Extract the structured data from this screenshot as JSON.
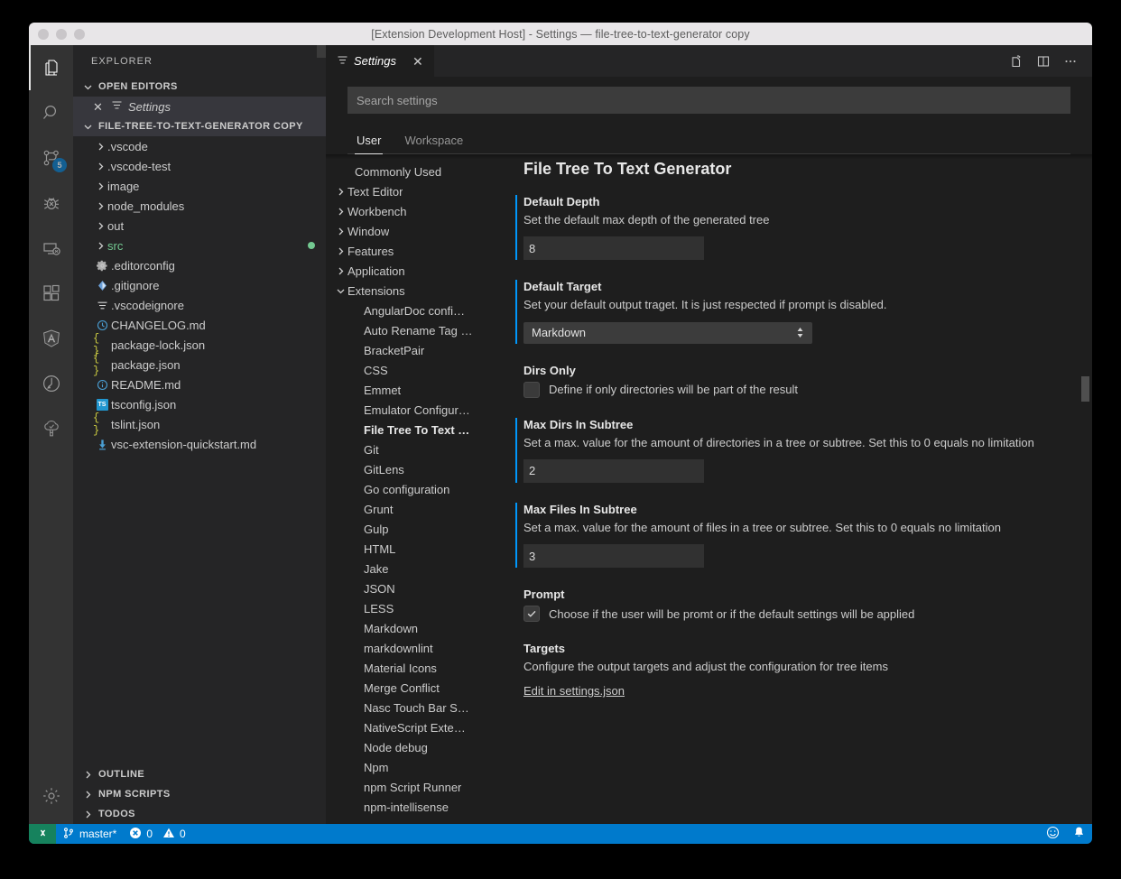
{
  "window": {
    "title": "[Extension Development Host] - Settings — file-tree-to-text-generator copy"
  },
  "activitybar": {
    "items": [
      {
        "name": "explorer",
        "icon": "files-icon",
        "badge": ""
      },
      {
        "name": "search",
        "icon": "search-icon",
        "badge": ""
      },
      {
        "name": "source-control",
        "icon": "source-control-icon",
        "badge": "5"
      },
      {
        "name": "debug",
        "icon": "debug-icon",
        "badge": ""
      },
      {
        "name": "remote",
        "icon": "remote-explorer-icon",
        "badge": ""
      },
      {
        "name": "extensions",
        "icon": "extensions-icon",
        "badge": ""
      },
      {
        "name": "angular",
        "icon": "angular-icon",
        "badge": ""
      },
      {
        "name": "todo-tree",
        "icon": "clock-arrow-icon",
        "badge": ""
      },
      {
        "name": "file-tree-generator",
        "icon": "tree-icon",
        "badge": ""
      }
    ],
    "manage_icon": "gear-icon"
  },
  "sidebar": {
    "title": "EXPLORER",
    "open_editors": {
      "label": "OPEN EDITORS",
      "items": [
        {
          "label": "Settings",
          "icon": "settings-lines-icon",
          "close": "✕"
        }
      ]
    },
    "folder": {
      "label": "FILE-TREE-TO-TEXT-GENERATOR COPY"
    },
    "tree": [
      {
        "label": ".vscode",
        "type": "folder",
        "icon": "",
        "modified": false
      },
      {
        "label": ".vscode-test",
        "type": "folder",
        "icon": "",
        "modified": false
      },
      {
        "label": "image",
        "type": "folder",
        "icon": "",
        "modified": false
      },
      {
        "label": "node_modules",
        "type": "folder",
        "icon": "",
        "modified": false
      },
      {
        "label": "out",
        "type": "folder",
        "icon": "",
        "modified": false
      },
      {
        "label": "src",
        "type": "folder",
        "icon": "",
        "modified": true
      },
      {
        "label": ".editorconfig",
        "type": "file",
        "icon": "gear-file-icon",
        "modified": false
      },
      {
        "label": ".gitignore",
        "type": "file",
        "icon": "git-file-icon",
        "modified": false
      },
      {
        "label": ".vscodeignore",
        "type": "file",
        "icon": "lines-file-icon",
        "modified": false
      },
      {
        "label": "CHANGELOG.md",
        "type": "file",
        "icon": "clock-file-icon",
        "modified": false
      },
      {
        "label": "package-lock.json",
        "type": "file",
        "icon": "json-file-icon",
        "modified": false
      },
      {
        "label": "package.json",
        "type": "file",
        "icon": "json-file-icon",
        "modified": false
      },
      {
        "label": "README.md",
        "type": "file",
        "icon": "info-file-icon",
        "modified": false
      },
      {
        "label": "tsconfig.json",
        "type": "file",
        "icon": "ts-file-icon",
        "modified": false
      },
      {
        "label": "tslint.json",
        "type": "file",
        "icon": "json-file-icon",
        "modified": false
      },
      {
        "label": "vsc-extension-quickstart.md",
        "type": "file",
        "icon": "download-file-icon",
        "modified": false
      }
    ],
    "bottom_sections": [
      {
        "label": "OUTLINE"
      },
      {
        "label": "NPM SCRIPTS"
      },
      {
        "label": "TODOS"
      }
    ]
  },
  "editor": {
    "tab": {
      "label": "Settings",
      "icon": "settings-lines-icon",
      "close": "✕"
    },
    "actions": [
      {
        "name": "open-settings-json",
        "icon": "open-file-icon"
      },
      {
        "name": "split-editor",
        "icon": "split-editor-icon"
      },
      {
        "name": "more-actions",
        "icon": "ellipsis-icon"
      }
    ]
  },
  "settings": {
    "search": {
      "placeholder": "Search settings",
      "value": ""
    },
    "scope_tabs": [
      {
        "label": "User",
        "active": true
      },
      {
        "label": "Workspace",
        "active": false
      }
    ],
    "toc": [
      {
        "label": "Commonly Used",
        "level": 1,
        "arrow": "none",
        "selected": false
      },
      {
        "label": "Text Editor",
        "level": 1,
        "arrow": "right",
        "selected": false
      },
      {
        "label": "Workbench",
        "level": 1,
        "arrow": "right",
        "selected": false
      },
      {
        "label": "Window",
        "level": 1,
        "arrow": "right",
        "selected": false
      },
      {
        "label": "Features",
        "level": 1,
        "arrow": "right",
        "selected": false
      },
      {
        "label": "Application",
        "level": 1,
        "arrow": "right",
        "selected": false
      },
      {
        "label": "Extensions",
        "level": 1,
        "arrow": "down",
        "selected": false
      },
      {
        "label": "AngularDoc confi…",
        "level": 2,
        "arrow": "none",
        "selected": false
      },
      {
        "label": "Auto Rename Tag …",
        "level": 2,
        "arrow": "none",
        "selected": false
      },
      {
        "label": "BracketPair",
        "level": 2,
        "arrow": "none",
        "selected": false
      },
      {
        "label": "CSS",
        "level": 2,
        "arrow": "none",
        "selected": false
      },
      {
        "label": "Emmet",
        "level": 2,
        "arrow": "none",
        "selected": false
      },
      {
        "label": "Emulator Configur…",
        "level": 2,
        "arrow": "none",
        "selected": false
      },
      {
        "label": "File Tree To Text …",
        "level": 2,
        "arrow": "none",
        "selected": true
      },
      {
        "label": "Git",
        "level": 2,
        "arrow": "none",
        "selected": false
      },
      {
        "label": "GitLens",
        "level": 2,
        "arrow": "none",
        "selected": false
      },
      {
        "label": "Go configuration",
        "level": 2,
        "arrow": "none",
        "selected": false
      },
      {
        "label": "Grunt",
        "level": 2,
        "arrow": "none",
        "selected": false
      },
      {
        "label": "Gulp",
        "level": 2,
        "arrow": "none",
        "selected": false
      },
      {
        "label": "HTML",
        "level": 2,
        "arrow": "none",
        "selected": false
      },
      {
        "label": "Jake",
        "level": 2,
        "arrow": "none",
        "selected": false
      },
      {
        "label": "JSON",
        "level": 2,
        "arrow": "none",
        "selected": false
      },
      {
        "label": "LESS",
        "level": 2,
        "arrow": "none",
        "selected": false
      },
      {
        "label": "Markdown",
        "level": 2,
        "arrow": "none",
        "selected": false
      },
      {
        "label": "markdownlint",
        "level": 2,
        "arrow": "none",
        "selected": false
      },
      {
        "label": "Material Icons",
        "level": 2,
        "arrow": "none",
        "selected": false
      },
      {
        "label": "Merge Conflict",
        "level": 2,
        "arrow": "none",
        "selected": false
      },
      {
        "label": "Nasc Touch Bar S…",
        "level": 2,
        "arrow": "none",
        "selected": false
      },
      {
        "label": "NativeScript Exte…",
        "level": 2,
        "arrow": "none",
        "selected": false
      },
      {
        "label": "Node debug",
        "level": 2,
        "arrow": "none",
        "selected": false
      },
      {
        "label": "Npm",
        "level": 2,
        "arrow": "none",
        "selected": false
      },
      {
        "label": "npm Script Runner",
        "level": 2,
        "arrow": "none",
        "selected": false
      },
      {
        "label": "npm-intellisense",
        "level": 2,
        "arrow": "none",
        "selected": false
      }
    ],
    "section_title": "File Tree To Text Generator",
    "items": [
      {
        "kind": "text",
        "label": "Default Depth",
        "description": "Set the default max depth of the generated tree",
        "value": "8",
        "modified": true
      },
      {
        "kind": "select",
        "label": "Default Target",
        "description": "Set your default output traget. It is just respected if prompt is disabled.",
        "value": "Markdown",
        "modified": true
      },
      {
        "kind": "checkbox",
        "label": "Dirs Only",
        "description": "Define if only directories will be part of the result",
        "checked": false,
        "modified": false
      },
      {
        "kind": "text",
        "label": "Max Dirs In Subtree",
        "description": "Set a max. value for the amount of directories in a tree or subtree. Set this to 0 equals no limitation",
        "value": "2",
        "modified": true
      },
      {
        "kind": "text",
        "label": "Max Files In Subtree",
        "description": "Set a max. value for the amount of files in a tree or subtree. Set this to 0 equals no limitation",
        "value": "3",
        "modified": true
      },
      {
        "kind": "checkbox",
        "label": "Prompt",
        "description": "Choose if the user will be promt or if the default settings will be applied",
        "checked": true,
        "modified": false
      },
      {
        "kind": "link",
        "label": "Targets",
        "description": "Configure the output targets and adjust the configuration for tree items",
        "link_label": "Edit in settings.json",
        "modified": false
      }
    ]
  },
  "statusbar": {
    "remote": {
      "icon": "remote-icon",
      "label": ""
    },
    "branch": {
      "icon": "git-branch-icon",
      "label": "master*"
    },
    "problems": {
      "errors": "0",
      "warnings": "0"
    },
    "right": [
      {
        "name": "feedback-smiley-icon"
      },
      {
        "name": "notifications-bell-icon"
      }
    ]
  },
  "colors": {
    "accent": "#007acc",
    "modified_bar": "#0097fb",
    "remote_green": "#16825d",
    "git_dot": "#73c991",
    "editor_bg": "#1e1e1e",
    "sidebar_bg": "#252526",
    "activitybar_bg": "#333333"
  }
}
